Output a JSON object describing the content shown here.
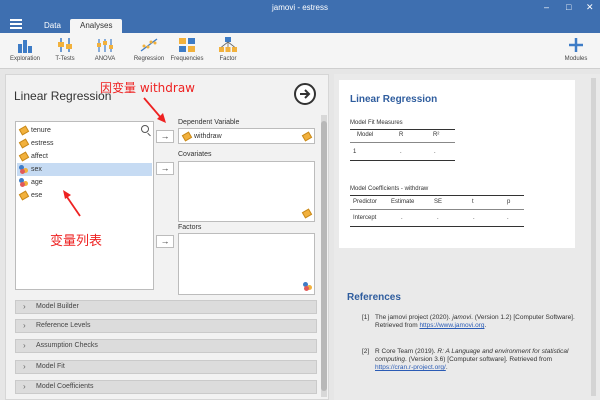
{
  "window": {
    "title": "jamovi - estress"
  },
  "tabs": [
    {
      "label": "Data",
      "active": false
    },
    {
      "label": "Analyses",
      "active": true
    }
  ],
  "ribbon": {
    "items": [
      {
        "label": "Exploration",
        "icon": "exploration-icon"
      },
      {
        "label": "T-Tests",
        "icon": "ttests-icon"
      },
      {
        "label": "ANOVA",
        "icon": "anova-icon"
      },
      {
        "label": "Regression",
        "icon": "regression-icon"
      },
      {
        "label": "Frequencies",
        "icon": "frequencies-icon"
      },
      {
        "label": "Factor",
        "icon": "factor-icon"
      }
    ],
    "modules_label": "Modules"
  },
  "analysis": {
    "title": "Linear Regression",
    "variables": [
      {
        "name": "tenure",
        "type": "continuous"
      },
      {
        "name": "estress",
        "type": "continuous"
      },
      {
        "name": "affect",
        "type": "continuous"
      },
      {
        "name": "sex",
        "type": "nominal",
        "selected": true
      },
      {
        "name": "age",
        "type": "nominal"
      },
      {
        "name": "ese",
        "type": "continuous"
      }
    ],
    "dependent_label": "Dependent Variable",
    "dependent_value": "withdraw",
    "covariates_label": "Covariates",
    "factors_label": "Factors",
    "move_arrow": "→",
    "sections": [
      "Model Builder",
      "Reference Levels",
      "Assumption Checks",
      "Model Fit",
      "Model Coefficients"
    ]
  },
  "annotations": {
    "dependent": "因变量 withdraw",
    "varlist": "变量列表"
  },
  "results": {
    "title": "Linear Regression",
    "model_fit": {
      "caption": "Model Fit Measures",
      "headers": [
        "Model",
        "R",
        "R²"
      ],
      "row": [
        "1",
        ".",
        "."
      ]
    },
    "coefficients": {
      "caption": "Model Coefficients - withdraw",
      "headers": [
        "Predictor",
        "Estimate",
        "SE",
        "t",
        "p"
      ],
      "row": [
        "Intercept",
        ".",
        ".",
        ".",
        "."
      ]
    }
  },
  "references": {
    "title": "References",
    "items": [
      {
        "num": "[1]",
        "pre": "The jamovi project (2020). ",
        "ital": "jamovi",
        "post": ". (Version 1.2) [Computer Software]. Retrieved from ",
        "link": "https://www.jamovi.org",
        "end": "."
      },
      {
        "num": "[2]",
        "pre": "R Core Team (2019). ",
        "ital": "R: A Language and environment for statistical computing",
        "post": ". (Version 3.6) [Computer software]. Retrieved from ",
        "link": "https://cran.r-project.org/",
        "end": "."
      }
    ]
  },
  "colors": {
    "titlebar": "#3e6fb0",
    "results_heading": "#2f5d9e",
    "annotation": "#ee2222"
  }
}
